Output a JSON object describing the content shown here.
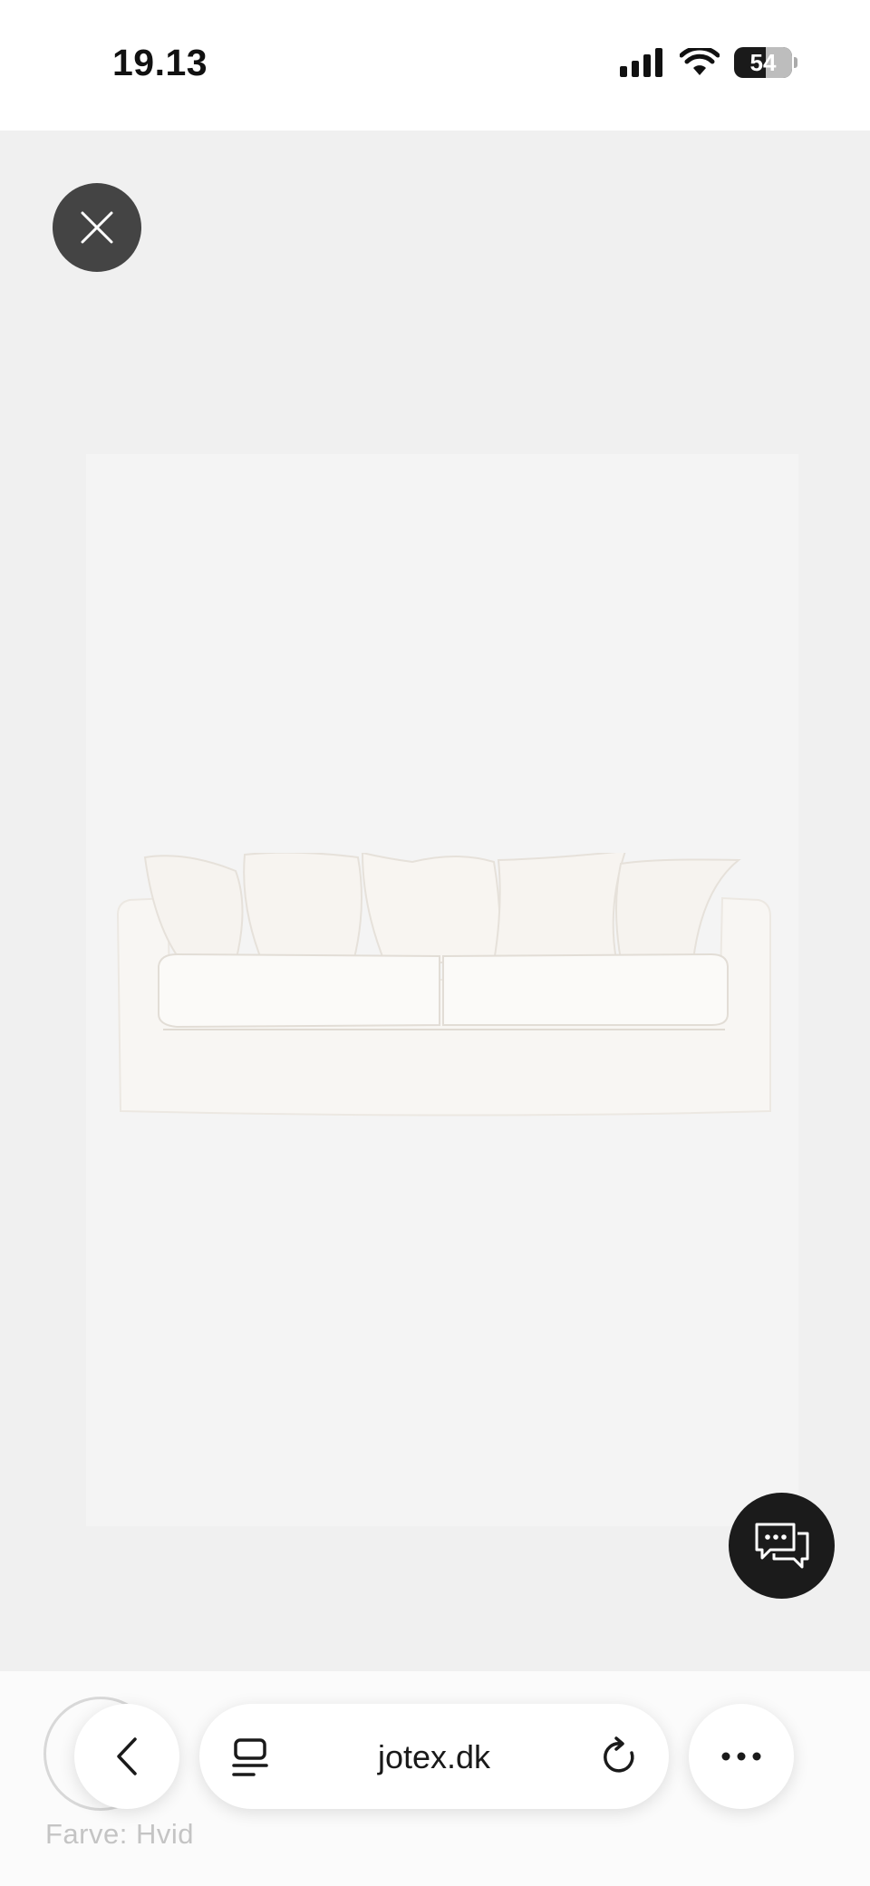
{
  "status_bar": {
    "time": "19.13",
    "battery": "54"
  },
  "viewer": {
    "close_icon": "close-icon",
    "chat_icon": "chat-bubbles-icon",
    "product_image": "white-linen-sofa"
  },
  "product": {
    "color_label": "Farve: Hvid"
  },
  "browser": {
    "url": "jotex.dk",
    "back_icon": "chevron-left-icon",
    "tabs_icon": "tabs-icon",
    "reload_icon": "reload-icon",
    "more_icon": "more-icon"
  },
  "colors": {
    "viewer_bg": "#f0f0f0",
    "close_button": "#444444",
    "chat_button": "#1b1b1b"
  }
}
